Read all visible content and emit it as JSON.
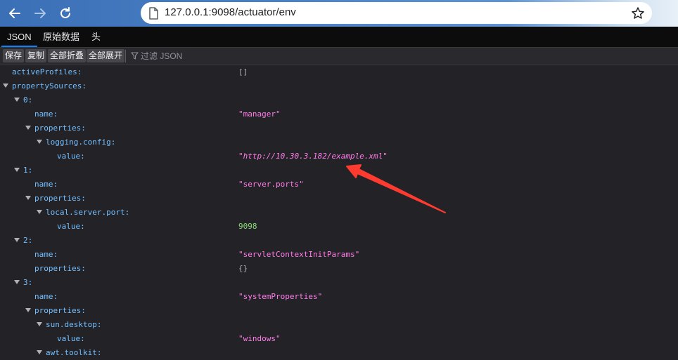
{
  "browser": {
    "url": "127.0.0.1:9098/actuator/env"
  },
  "viewer": {
    "tabs": [
      "JSON",
      "原始数据",
      "头"
    ],
    "active_tab": "JSON"
  },
  "toolbar": {
    "save_label": "保存",
    "copy_label": "复制",
    "collapse_all_label": "全部折叠",
    "expand_all_label": "全部展开",
    "filter_placeholder": "过滤 JSON"
  },
  "json_rows": [
    {
      "depth": 0,
      "expandable": false,
      "key": "activeProfiles:",
      "value": "[]",
      "type": "obj"
    },
    {
      "depth": 0,
      "expandable": true,
      "key": "propertySources:",
      "value": "",
      "type": ""
    },
    {
      "depth": 1,
      "expandable": true,
      "key": "0:",
      "value": "",
      "type": ""
    },
    {
      "depth": 2,
      "expandable": false,
      "key": "name:",
      "value": "\"manager\"",
      "type": "str"
    },
    {
      "depth": 2,
      "expandable": true,
      "key": "properties:",
      "value": "",
      "type": ""
    },
    {
      "depth": 3,
      "expandable": true,
      "key": "logging.config:",
      "value": "",
      "type": ""
    },
    {
      "depth": 4,
      "expandable": false,
      "key": "value:",
      "value": "\"http://10.30.3.182/example.xml\"",
      "type": "str-url"
    },
    {
      "depth": 1,
      "expandable": true,
      "key": "1:",
      "value": "",
      "type": ""
    },
    {
      "depth": 2,
      "expandable": false,
      "key": "name:",
      "value": "\"server.ports\"",
      "type": "str"
    },
    {
      "depth": 2,
      "expandable": true,
      "key": "properties:",
      "value": "",
      "type": ""
    },
    {
      "depth": 3,
      "expandable": true,
      "key": "local.server.port:",
      "value": "",
      "type": ""
    },
    {
      "depth": 4,
      "expandable": false,
      "key": "value:",
      "value": "9098",
      "type": "num"
    },
    {
      "depth": 1,
      "expandable": true,
      "key": "2:",
      "value": "",
      "type": ""
    },
    {
      "depth": 2,
      "expandable": false,
      "key": "name:",
      "value": "\"servletContextInitParams\"",
      "type": "str"
    },
    {
      "depth": 2,
      "expandable": false,
      "key": "properties:",
      "value": "{}",
      "type": "obj"
    },
    {
      "depth": 1,
      "expandable": true,
      "key": "3:",
      "value": "",
      "type": ""
    },
    {
      "depth": 2,
      "expandable": false,
      "key": "name:",
      "value": "\"systemProperties\"",
      "type": "str"
    },
    {
      "depth": 2,
      "expandable": true,
      "key": "properties:",
      "value": "",
      "type": ""
    },
    {
      "depth": 3,
      "expandable": true,
      "key": "sun.desktop:",
      "value": "",
      "type": ""
    },
    {
      "depth": 4,
      "expandable": false,
      "key": "value:",
      "value": "\"windows\"",
      "type": "str"
    },
    {
      "depth": 3,
      "expandable": true,
      "key": "awt.toolkit:",
      "value": "",
      "type": ""
    }
  ],
  "colors": {
    "key": "#75bfff",
    "string": "#ff7de9",
    "number": "#86de74",
    "annotation_arrow": "#ff3b30"
  },
  "icons": {
    "back": "arrow-left-icon",
    "forward": "arrow-right-icon",
    "reload": "reload-icon",
    "page_info": "page-info-icon",
    "bookmark": "star-icon",
    "filter": "filter-icon",
    "twisty": "triangle-down-icon",
    "annotation": "red-arrow-icon"
  }
}
